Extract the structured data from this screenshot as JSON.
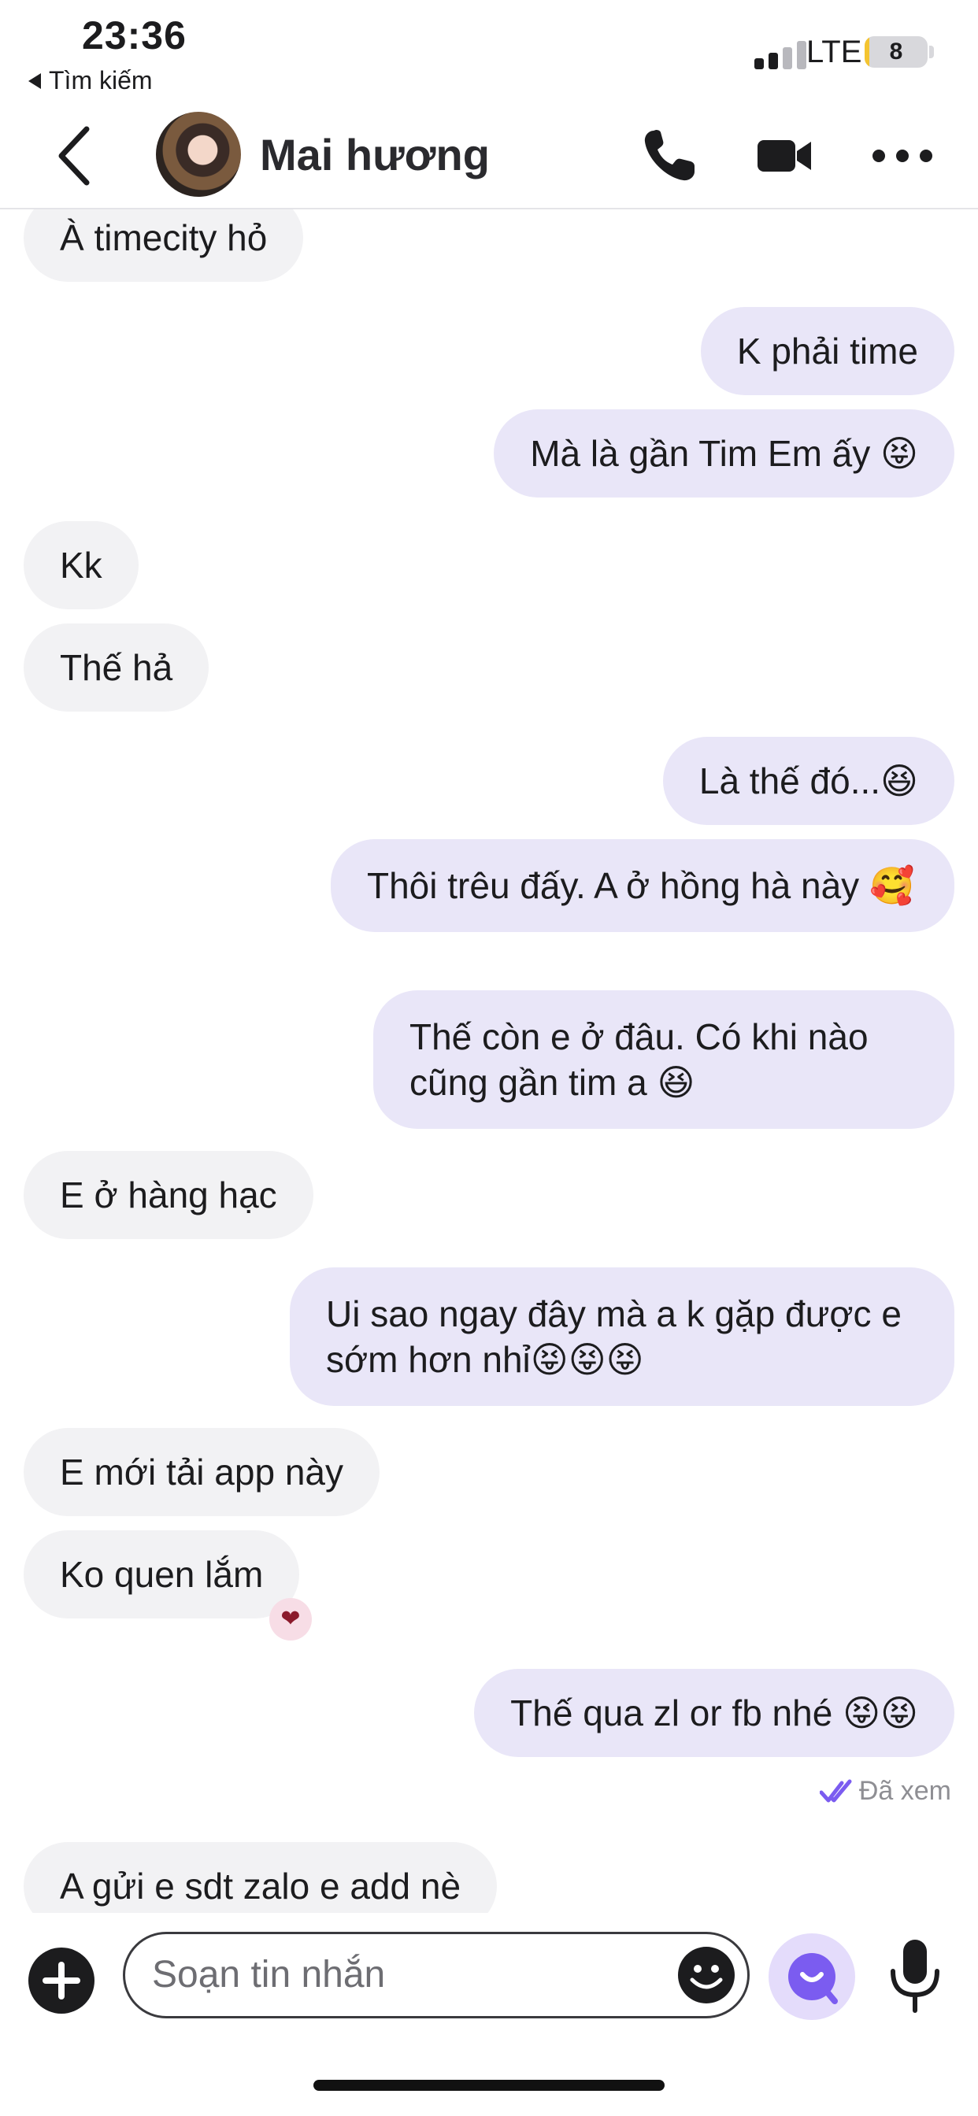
{
  "status_bar": {
    "time": "23:36",
    "back_app": "Tìm kiếm",
    "network": "LTE",
    "battery": "8",
    "battery_level": 0.08
  },
  "header": {
    "contact_name": "Mai hương"
  },
  "messages": [
    {
      "side": "in",
      "text": "À timecity hỏ"
    },
    {
      "side": "out",
      "text": "K phải time"
    },
    {
      "side": "out",
      "text": "Mà là gần  Tim Em ấy 😝"
    },
    {
      "side": "in",
      "text": "Kk"
    },
    {
      "side": "in",
      "text": "Thế hả"
    },
    {
      "side": "out",
      "text": "Là thế đó...😆"
    },
    {
      "side": "out",
      "text": "Thôi trêu đấy. A ở hồng hà này 🥰"
    },
    {
      "side": "out",
      "text": "Thế còn e ở đâu. Có khi nào cũng gần tim a 😆"
    },
    {
      "side": "in",
      "text": "E ở hàng hạc"
    },
    {
      "side": "out",
      "text": "Ui sao ngay đây mà a k gặp được e sớm hơn nhỉ😝😝😝"
    },
    {
      "side": "in",
      "text": "E mới tải app này"
    },
    {
      "side": "in",
      "text": "Ko quen lắm",
      "reaction": "heart"
    },
    {
      "side": "out",
      "text": "Thế qua zl or fb  nhé 😝😝"
    },
    {
      "side": "in",
      "text": "A gửi e sdt zalo e add nè"
    }
  ],
  "seen_label": "Đã xem",
  "composer": {
    "placeholder": "Soạn tin nhắn"
  },
  "icons": {
    "back": "chevron-left-icon",
    "call": "phone-icon",
    "video": "video-camera-icon",
    "more": "more-dots-icon",
    "plus": "plus-icon",
    "emoji": "emoji-icon",
    "ai": "ai-assistant-icon",
    "mic": "microphone-icon",
    "seen": "double-check-icon"
  },
  "colors": {
    "incoming_bubble": "#f2f2f4",
    "outgoing_bubble": "#e9e6f8",
    "accent": "#7b5cf0",
    "battery": "#f4c430"
  }
}
